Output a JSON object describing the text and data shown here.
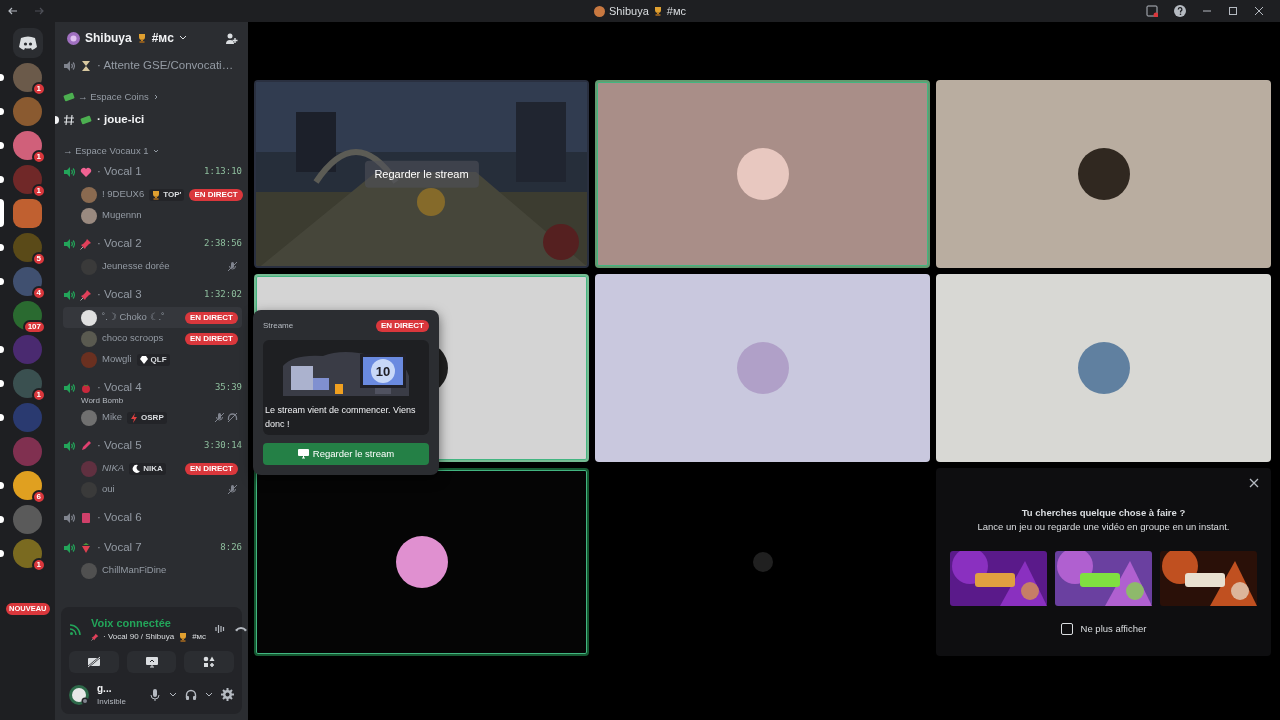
{
  "window": {
    "title": "Shibuya",
    "channel": "#ᴍᴄ"
  },
  "servers": [
    {
      "color": "#6b5a4a",
      "badge": "1",
      "unread": true,
      "selected": false
    },
    {
      "color": "#8a5a30",
      "unread": true,
      "selected": false
    },
    {
      "color": "#d0607a",
      "badge": "1",
      "unread": true,
      "selected": false
    },
    {
      "color": "#702828",
      "badge": "1",
      "unread": true,
      "selected": false
    },
    {
      "color": "#c06030",
      "selected": true
    },
    {
      "color": "#5a4a18",
      "badge": "5",
      "unread": true,
      "selected": false
    },
    {
      "color": "#405070",
      "badge": "4",
      "unread": true,
      "selected": false
    },
    {
      "color": "#2a6a30",
      "badge": "107",
      "selected": false
    },
    {
      "color": "#4a2a70",
      "unread": true,
      "selected": false
    },
    {
      "color": "#3a5050",
      "badge": "1",
      "unread": true,
      "selected": false
    },
    {
      "color": "#2a3a70",
      "unread": true,
      "selected": false
    },
    {
      "color": "#803050",
      "selected": false
    },
    {
      "color": "#e0a020",
      "badge": "6",
      "unread": true,
      "selected": false
    },
    {
      "color": "#5a5a5a",
      "unread": true,
      "selected": false
    },
    {
      "color": "#7a6a20",
      "badge": "1",
      "unread": true,
      "selected": false
    }
  ],
  "new_badge": "NOUVEAU",
  "server_header": {
    "name": "Shibuya",
    "channel": "#ᴍᴄ"
  },
  "channels": [
    {
      "kind": "voice",
      "active": false,
      "name": "· Attente GSE/Convocati…"
    },
    {
      "kind": "category",
      "name": "→ Espace Coins",
      "expanded": false
    },
    {
      "kind": "text",
      "name": "· joue-ici",
      "unread": true
    },
    {
      "kind": "category",
      "name": "→ Espace Vocaux 1",
      "expanded": true
    },
    {
      "kind": "voice",
      "active": true,
      "name": "· Vocal 1",
      "timer": "1:13:10",
      "members": [
        {
          "name": "! 9DEUX6",
          "color": "#8a6a50",
          "tag": "TOP'",
          "live": "EN DIRECT"
        },
        {
          "name": "Mugennn",
          "color": "#9a8a80"
        }
      ]
    },
    {
      "kind": "voice",
      "active": true,
      "name": "· Vocal 2",
      "timer": "2:38:56",
      "members": [
        {
          "name": "Jeunesse dorée",
          "color": "#3a3a3a",
          "muted": true
        }
      ]
    },
    {
      "kind": "voice",
      "active": true,
      "name": "· Vocal 3",
      "timer": "1:32:02",
      "members": [
        {
          "name": "˚.☽ Choko ☾.˚",
          "color": "#e0e0e0",
          "live": "EN DIRECT",
          "hovered": true
        },
        {
          "name": "choco scroops",
          "color": "#5a5a50",
          "live": "EN DIRECT"
        },
        {
          "name": "Mowgli",
          "color": "#6a3020",
          "tag": "QLF"
        }
      ]
    },
    {
      "kind": "voice",
      "active": true,
      "name": "· Vocal 4",
      "timer": "35:39",
      "activity": "Word Bomb",
      "members": [
        {
          "name": "Mike",
          "color": "#707070",
          "tag": "OSRP",
          "muted": true,
          "deafened": true
        }
      ]
    },
    {
      "kind": "voice",
      "active": true,
      "name": "· Vocal 5",
      "timer": "3:30:14",
      "members": [
        {
          "name": "NIKA",
          "color": "#603040",
          "tag": "NIKA",
          "live": "EN DIRECT"
        },
        {
          "name": "oui",
          "color": "#3a3a3a",
          "muted": true
        }
      ]
    },
    {
      "kind": "voice",
      "active": false,
      "name": "· Vocal 6"
    },
    {
      "kind": "voice",
      "active": true,
      "name": "· Vocal 7",
      "timer": "8:26",
      "members": [
        {
          "name": "ChillManFiDine",
          "color": "#505050"
        }
      ]
    }
  ],
  "voice_panel": {
    "status": "Voix connectée",
    "channel": "· Vocal 90 / Shibuya",
    "server_channel": "#ᴍᴄ"
  },
  "user": {
    "name": "g...",
    "status": "Invisible"
  },
  "tiles": [
    {
      "kind": "stream",
      "speaking": false,
      "button": "Regarder le stream"
    },
    {
      "kind": "avatar",
      "speaking": true,
      "color": "#a98e88"
    },
    {
      "kind": "avatar",
      "speaking": false,
      "color": "#b9ada0"
    },
    {
      "kind": "avatar",
      "speaking": true,
      "color": "#d4d4d4"
    },
    {
      "kind": "avatar",
      "speaking": false,
      "color": "#c9c8de"
    },
    {
      "kind": "avatar",
      "speaking": false,
      "color": "#d8d8d4"
    },
    {
      "kind": "avatar",
      "speaking": true,
      "color": "#050505"
    },
    {
      "kind": "mini-avatar",
      "speaking": false,
      "color": "#000000"
    }
  ],
  "activity_panel": {
    "title": "Tu cherches quelque chose à faire ?",
    "subtitle": "Lance un jeu ou regarde une vidéo en groupe en un instant.",
    "checkbox": {
      "label": "Ne plus afficher",
      "checked": false
    }
  },
  "popup": {
    "title": "Streame",
    "live": "EN DIRECT",
    "countdown": "10",
    "message": "Le stream vient de commencer. Viens donc !",
    "button": "Regarder le stream"
  }
}
